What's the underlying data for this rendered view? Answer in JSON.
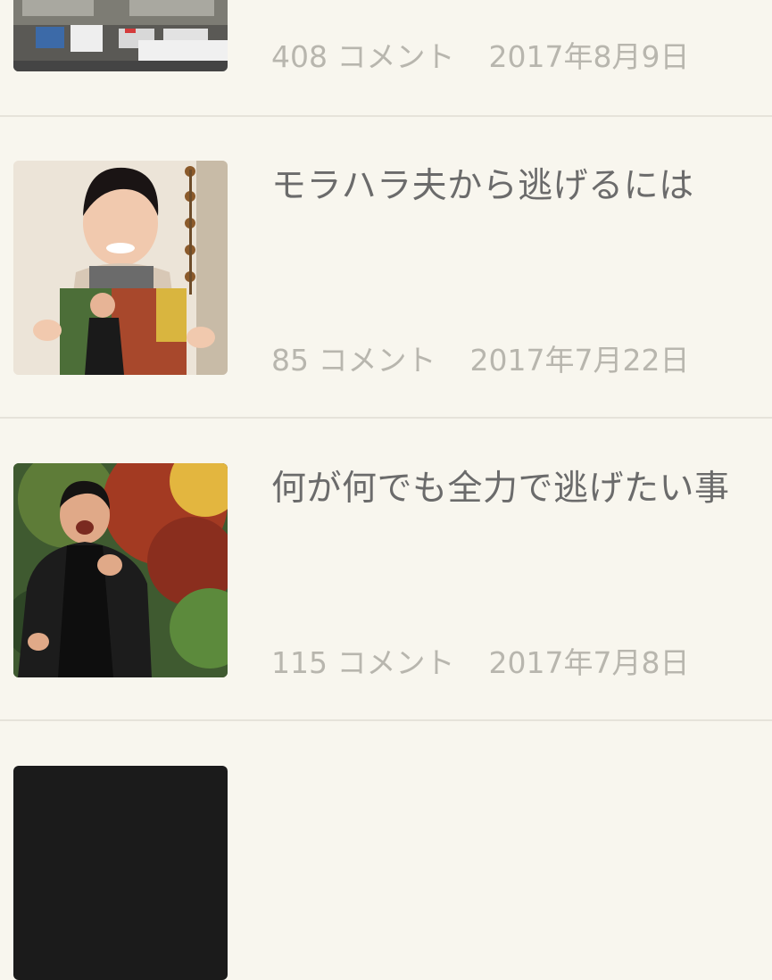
{
  "items": [
    {
      "thumb_alt": "building-parking-lot",
      "title": "",
      "comments": "408 コメント",
      "date": "2017年8月9日"
    },
    {
      "thumb_alt": "woman-holding-photo",
      "title": "モラハラ夫から逃げるには",
      "comments": "85 コメント",
      "date": "2017年7月22日"
    },
    {
      "thumb_alt": "man-running",
      "title": "何が何でも全力で逃げたい事",
      "comments": "115 コメント",
      "date": "2017年7月8日"
    },
    {
      "thumb_alt": "dark-image",
      "title": "",
      "comments": "",
      "date": ""
    }
  ]
}
